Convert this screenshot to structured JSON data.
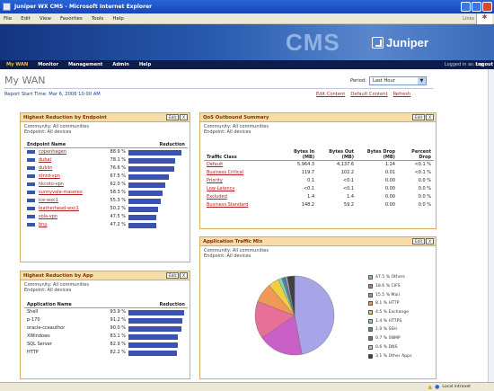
{
  "window": {
    "title": "Juniper WX CMS - Microsoft Internet Explorer"
  },
  "menu": [
    "File",
    "Edit",
    "View",
    "Favorites",
    "Tools",
    "Help"
  ],
  "links_label": "Links",
  "banner": {
    "cms": "CMS",
    "brand": "Juniper",
    "brand_sub": "NETWORKS"
  },
  "nav": {
    "items": [
      "My WAN",
      "Monitor",
      "Management",
      "Admin",
      "Help"
    ],
    "logged": "Logged in as: mp",
    "logout": "Logout"
  },
  "page": {
    "title": "My WAN",
    "start_time": "Report Start Time: Mar 6, 2006 10:00 AM",
    "period_label": "Period:",
    "period_value": "Last Hour",
    "links": [
      "Edit Content",
      "Default Content",
      "Refresh"
    ]
  },
  "endpoint": {
    "title": "Highest Reduction by Endpoint",
    "edit": "Edit",
    "close": "X",
    "community": "Community: All communities",
    "endpoints": "Endpoint: All devices",
    "col1": "Endpoint Name",
    "col2": "Reduction",
    "rows": [
      {
        "name": "copenhagen",
        "pct": "88.9 %",
        "v": 88.9
      },
      {
        "name": "dubai",
        "pct": "78.1 %",
        "v": 78.1
      },
      {
        "name": "dublin",
        "pct": "76.6 %",
        "v": 76.6
      },
      {
        "name": "stnrd-vpn",
        "pct": "67.5 %",
        "v": 67.5
      },
      {
        "name": "hkcoto-vpn",
        "pct": "62.0 %",
        "v": 62.0
      },
      {
        "name": "sunnyvale-maserex",
        "pct": "58.3 %",
        "v": 58.3
      },
      {
        "name": "ice-wxc1",
        "pct": "55.3 %",
        "v": 55.3
      },
      {
        "name": "leatherhead-wxc1",
        "pct": "50.2 %",
        "v": 50.2
      },
      {
        "name": "sola-vpn",
        "pct": "47.5 %",
        "v": 47.5
      },
      {
        "name": "bnu",
        "pct": "47.2 %",
        "v": 47.2
      }
    ]
  },
  "app": {
    "title": "Highest Reduction by App",
    "edit": "Edit",
    "close": "X",
    "community": "Community: All communities",
    "endpoints": "Endpoint: All devices",
    "col1": "Application Name",
    "col2": "Reduction",
    "rows": [
      {
        "name": "Shell",
        "pct": "93.9 %",
        "v": 93.9
      },
      {
        "name": "p-170",
        "pct": "91.2 %",
        "v": 91.2
      },
      {
        "name": "oracle-cceauthor",
        "pct": "90.0 %",
        "v": 90.0
      },
      {
        "name": "XWindows",
        "pct": "83.1 %",
        "v": 83.1
      },
      {
        "name": "SQL Server",
        "pct": "82.9 %",
        "v": 82.9
      },
      {
        "name": "HTTP",
        "pct": "82.2 %",
        "v": 82.2
      }
    ]
  },
  "qos": {
    "title": "QoS Outbound Summary",
    "edit": "Edit",
    "close": "X",
    "community": "Community: All communities",
    "endpoints": "Endpoint: All devices",
    "cols": [
      "Traffic Class",
      "Bytes In (MB)",
      "Bytes Out (MB)",
      "Bytes Drop (MB)",
      "Percent Drop"
    ],
    "rows": [
      [
        "Default",
        "5,964.3",
        "4,137.6",
        "1.24",
        "<0.1 %"
      ],
      [
        "Business Critical",
        "119.7",
        "102.2",
        "0.01",
        "<0.1 %"
      ],
      [
        "Priority",
        "0.1",
        "<0.1",
        "0.00",
        "0.0 %"
      ],
      [
        "Low-Latency",
        "<0.1",
        "<0.1",
        "0.00",
        "0.0 %"
      ],
      [
        "Excluded",
        "1.4",
        "1.4",
        "0.00",
        "0.0 %"
      ],
      [
        "Business Standard",
        "148.2",
        "59.2",
        "0.00",
        "0.0 %"
      ]
    ]
  },
  "mix": {
    "title": "Application Traffic Mix",
    "edit": "Edit",
    "close": "X",
    "community": "Community: All communities",
    "endpoints": "Endpoint: All devices"
  },
  "chart_data": {
    "type": "pie",
    "labels": [
      "47.5 % Others",
      "18.6 % CIFS",
      "15.5 % Mail",
      "8.1 % HTTP",
      "4.5 % Exchange",
      "1.4 % HTTPS",
      "1.0 % SSH",
      "0.7 % SNMP",
      "0.6 % DNS",
      "3.1 % Other Apps"
    ],
    "values": [
      47.5,
      18.6,
      15.5,
      8.1,
      4.5,
      1.4,
      1.0,
      0.7,
      0.6,
      3.1
    ],
    "colors": [
      "#a8a4e8",
      "#c860c8",
      "#e87098",
      "#f09858",
      "#f0d040",
      "#80d8c8",
      "#3c9a88",
      "#7060c0",
      "#c0c0c0",
      "#404040"
    ]
  },
  "status": {
    "zone": "Local intranet"
  }
}
